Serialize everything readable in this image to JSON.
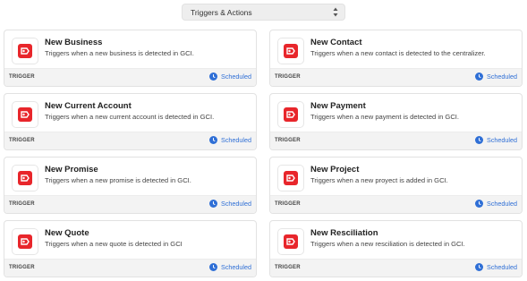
{
  "selector": {
    "label": "Triggers & Actions"
  },
  "accent": "#e8262b",
  "schedule_color": "#2f6fd6",
  "cards": [
    {
      "title": "New Business",
      "description": "Triggers when a new business is detected in GCI.",
      "type": "TRIGGER",
      "schedule": "Scheduled"
    },
    {
      "title": "New Contact",
      "description": "Triggers when a new contact is detected to the centralizer.",
      "type": "TRIGGER",
      "schedule": "Scheduled"
    },
    {
      "title": "New Current Account",
      "description": "Triggers when a new current account is detected in GCI.",
      "type": "TRIGGER",
      "schedule": "Scheduled"
    },
    {
      "title": "New Payment",
      "description": "Triggers when a new payment is detected in GCI.",
      "type": "TRIGGER",
      "schedule": "Scheduled"
    },
    {
      "title": "New Promise",
      "description": "Triggers when a new promise is detected in GCI.",
      "type": "TRIGGER",
      "schedule": "Scheduled"
    },
    {
      "title": "New Project",
      "description": "Triggers when a new proyect is added in GCI.",
      "type": "TRIGGER",
      "schedule": "Scheduled"
    },
    {
      "title": "New Quote",
      "description": "Triggers when a new quote is detected in GCI",
      "type": "TRIGGER",
      "schedule": "Scheduled"
    },
    {
      "title": "New Resciliation",
      "description": "Triggers when a new resciliation is detected in GCI.",
      "type": "TRIGGER",
      "schedule": "Scheduled"
    }
  ]
}
